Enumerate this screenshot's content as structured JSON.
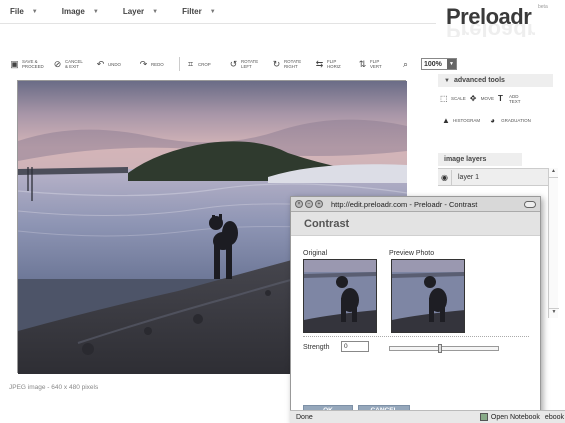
{
  "menu": [
    {
      "label": "File"
    },
    {
      "label": "Image"
    },
    {
      "label": "Layer"
    },
    {
      "label": "Filter"
    }
  ],
  "logo": {
    "text": "Preloadr",
    "beta": "beta"
  },
  "toolbar": {
    "buttons": [
      {
        "label": "SAVE &\nPROCEED",
        "icon": "save-icon"
      },
      {
        "label": "CANCEL\n& EXIT",
        "icon": "cancel-icon"
      },
      {
        "label": "UNDO",
        "icon": "undo-icon"
      },
      {
        "label": "REDO",
        "icon": "redo-icon"
      },
      {
        "label": "CROP",
        "icon": "crop-icon"
      },
      {
        "label": "ROTATE\nLEFT",
        "icon": "rotate-left-icon"
      },
      {
        "label": "ROTATE\nRIGHT",
        "icon": "rotate-right-icon"
      },
      {
        "label": "FLIP\nHORIZ",
        "icon": "flip-horizontal-icon"
      },
      {
        "label": "FLIP\nVERT",
        "icon": "flip-vertical-icon"
      }
    ],
    "zoom": "100%"
  },
  "image_info": "JPEG image - 640 x 480 pixels",
  "advanced_tools": {
    "title": "advanced tools",
    "items": [
      {
        "label": "SCALE",
        "icon": "scale-icon"
      },
      {
        "label": "MOVE",
        "icon": "move-icon"
      },
      {
        "label": "ADD\nTEXT",
        "icon": "add-text-icon"
      },
      {
        "label": "HISTOGRAM",
        "icon": "histogram-icon"
      },
      {
        "label": "GRADUATION",
        "icon": "graduation-icon"
      }
    ]
  },
  "layers": {
    "title": "image layers",
    "items": [
      {
        "label": "layer 1"
      }
    ]
  },
  "popup": {
    "window_title": "http://edit.preloadr.com - Preloadr - Contrast",
    "dialog_title": "Contrast",
    "original_label": "Original",
    "preview_label": "Preview Photo",
    "strength_label": "Strength",
    "strength_value": "0",
    "strength_level": 0.45,
    "ok": "OK",
    "cancel": "CANCEL"
  },
  "statusbar": {
    "done": "Done",
    "notebook": "Open Notebook",
    "notebook_tail": "ebook"
  }
}
